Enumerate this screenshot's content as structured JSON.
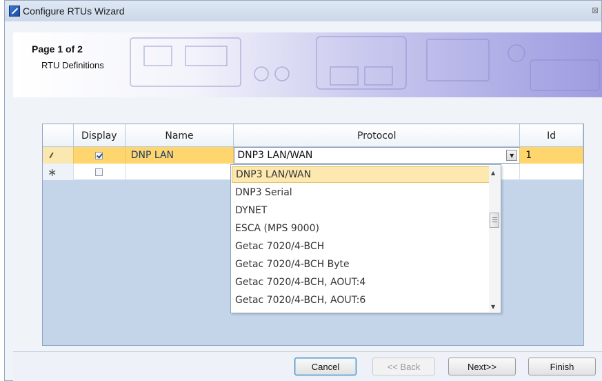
{
  "window": {
    "title": "Configure RTUs Wizard",
    "close_glyph": "⊠",
    "icon": "wizard-icon"
  },
  "banner": {
    "page": "Page 1 of 2",
    "subtitle": "RTU Definitions"
  },
  "grid": {
    "columns": [
      "Display",
      "Name",
      "Protocol",
      "Id"
    ],
    "rows": [
      {
        "indicator": "pencil-icon",
        "display_checked": true,
        "name": "DNP LAN",
        "protocol": "DNP3 LAN/WAN",
        "id": "1"
      },
      {
        "indicator": "star-icon",
        "star_glyph": "∗",
        "display_checked": false,
        "name": "",
        "protocol": "",
        "id": ""
      }
    ]
  },
  "dropdown": {
    "selected": "DNP3 LAN/WAN",
    "options": [
      "DNP3 LAN/WAN",
      "DNP3 Serial",
      "DYNET",
      "ESCA (MPS 9000)",
      "Getac 7020/4-BCH",
      "Getac 7020/4-BCH Byte",
      "Getac 7020/4-BCH, AOUT:4",
      "Getac 7020/4-BCH, AOUT:6"
    ]
  },
  "buttons": {
    "cancel": "Cancel",
    "back": "<< Back",
    "next": "Next>>",
    "finish": "Finish"
  },
  "colors": {
    "selected_row": "#ffd66e",
    "grid_background": "#c4d5ea",
    "banner_accent": "#9e9ce0"
  }
}
